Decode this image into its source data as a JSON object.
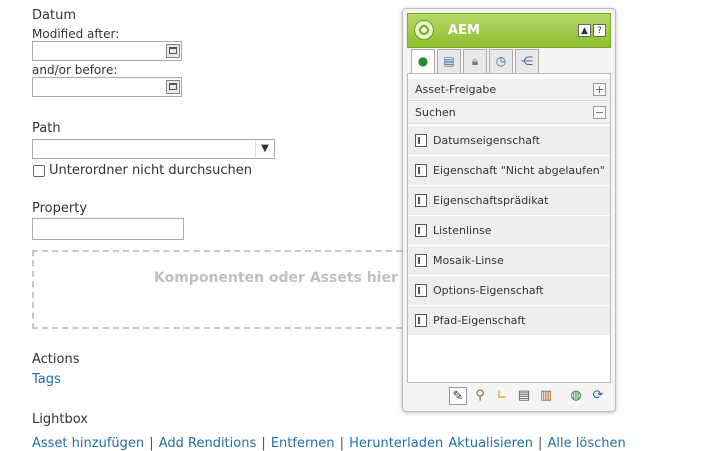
{
  "form": {
    "datum_title": "Datum",
    "modified_after_label": "Modified after:",
    "and_before_label": "and/or before:",
    "path_title": "Path",
    "checkbox_label": "Unterordner nicht durchsuchen",
    "property_title": "Property",
    "dropzone_text": "Komponenten oder Assets hier",
    "actions_title": "Actions",
    "actions_link": "Tags",
    "lightbox_title": "Lightbox",
    "lightbox_links": [
      "Asset hinzufügen",
      "Add Renditions",
      "Entfernen",
      "Herunterladen",
      "Aktualisieren",
      "Alle löschen"
    ],
    "separator": "|"
  },
  "panel": {
    "title": "AEM",
    "collapse_label": "▲",
    "help_label": "?",
    "tabs": [
      "components-tab",
      "content-tab",
      "lock-tab",
      "history-tab",
      "workflow-tab"
    ],
    "groups": [
      {
        "label": "Asset-Freigabe",
        "toggle": "+"
      },
      {
        "label": "Suchen",
        "toggle": "−"
      }
    ],
    "items": [
      "Datumseigenschaft",
      "Eigenschaft \"Nicht abgelaufen\"",
      "Eigenschaftsprädikat",
      "Listenlinse",
      "Mosaik-Linse",
      "Options-Eigenschaft",
      "Pfad-Eigenschaft"
    ],
    "toolbar_icons": [
      "edit-icon",
      "search-icon",
      "design-icon",
      "page-icon",
      "scaffolding-icon",
      "globe-icon",
      "refresh-icon"
    ]
  },
  "colors": {
    "link": "#1f6fa8",
    "panel_header": "#8cbf2c"
  }
}
